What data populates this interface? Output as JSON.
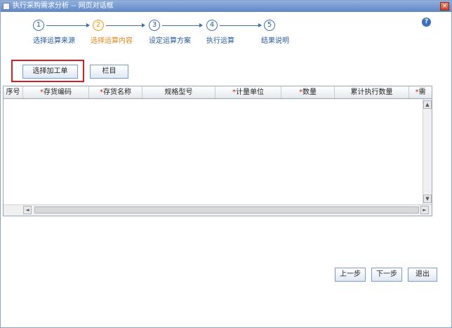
{
  "window": {
    "title": "执行采购需求分析 -- 网页对话框",
    "close_glyph": "×"
  },
  "help": {
    "glyph": "?"
  },
  "wizard": {
    "steps": [
      {
        "number": "1",
        "label": "选择运算来源"
      },
      {
        "number": "2",
        "label": "选择运算内容"
      },
      {
        "number": "3",
        "label": "设定运算方案"
      },
      {
        "number": "4",
        "label": "执行运算"
      },
      {
        "number": "5",
        "label": "结果说明"
      }
    ],
    "active_step": 2
  },
  "toolbar": {
    "select_order_label": "选择加工单",
    "columns_label": "栏目"
  },
  "grid": {
    "required_mark": "*",
    "columns": [
      {
        "label": "序号",
        "required": false
      },
      {
        "label": "存货编码",
        "required": true
      },
      {
        "label": "存货名称",
        "required": true
      },
      {
        "label": "规格型号",
        "required": false
      },
      {
        "label": "计量单位",
        "required": true
      },
      {
        "label": "数量",
        "required": true
      },
      {
        "label": "累计执行数量",
        "required": false
      },
      {
        "label": "需",
        "required": true
      }
    ],
    "rows": []
  },
  "scrollbar": {
    "up": "▲",
    "down": "▼",
    "left": "◄",
    "right": "►"
  },
  "footer": {
    "prev_label": "上一步",
    "next_label": "下一步",
    "exit_label": "退出"
  },
  "colors": {
    "accent": "#3a6fb0",
    "active_step": "#e08a20",
    "highlight": "#d02020"
  }
}
